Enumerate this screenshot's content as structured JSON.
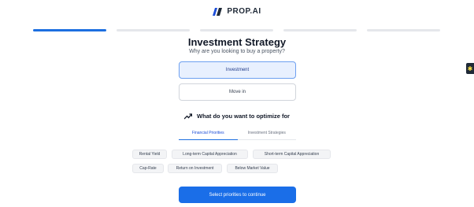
{
  "brand": {
    "name": "PROP.AI",
    "logo_icon": "slash-logo-icon",
    "accent": "#1d6fe0"
  },
  "progress": {
    "total_steps": 5,
    "current_step": 1
  },
  "header": {
    "title": "Investment Strategy",
    "subtitle": "Why are you looking to buy a property?"
  },
  "purpose_options": [
    {
      "label": "Investment",
      "selected": true
    },
    {
      "label": "Move in",
      "selected": false
    }
  ],
  "optimize": {
    "icon": "trending-up-icon",
    "label": "What do you want to optimize for"
  },
  "tabs": [
    {
      "label": "Financial Priorities",
      "active": true
    },
    {
      "label": "Investment Strategies",
      "active": false
    }
  ],
  "priorities": [
    "Rental Yield",
    "Long-term Capital Appreciation",
    "Short-term Capital Appreciation",
    "Cap-Rate",
    "Return on Investment",
    "Below Market Value"
  ],
  "cta": {
    "label": "Select priorities to continue"
  },
  "side_widget": {
    "icon": "sparkle-icon"
  }
}
